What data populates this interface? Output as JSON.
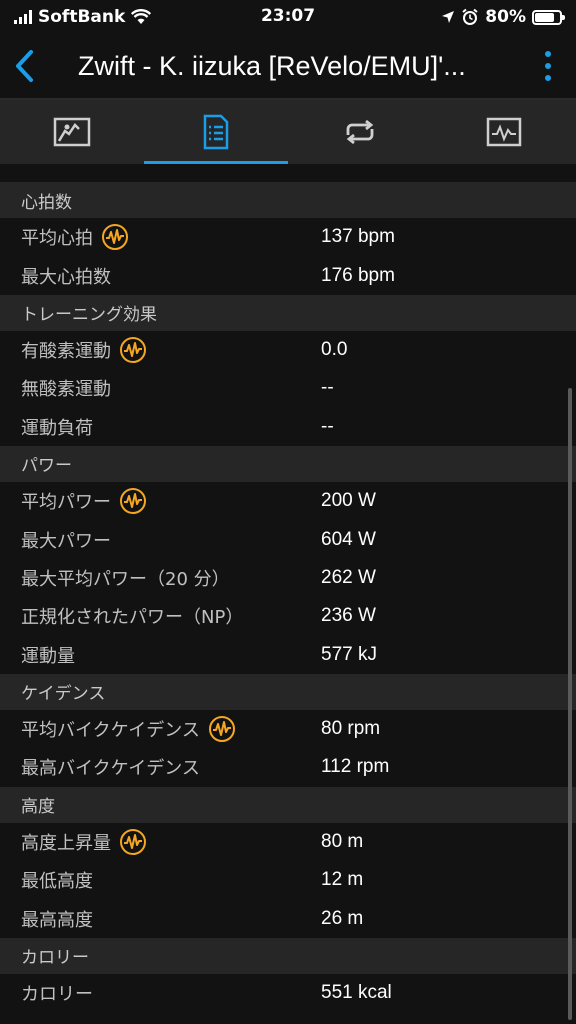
{
  "status_bar": {
    "carrier": "SoftBank",
    "time": "23:07",
    "battery": "80%",
    "battery_level": 0.8
  },
  "header": {
    "title": "Zwift - K. iizuka [ReVelo/EMU]'..."
  },
  "tabs": [
    {
      "name": "map",
      "icon": "map-icon",
      "active": false
    },
    {
      "name": "details",
      "icon": "document-icon",
      "active": true
    },
    {
      "name": "laps",
      "icon": "repeat-icon",
      "active": false
    },
    {
      "name": "charts",
      "icon": "chart-icon",
      "active": false
    }
  ],
  "sections": [
    {
      "title": "心拍数",
      "rows": [
        {
          "label": "平均心拍",
          "value": "137 bpm",
          "badge": true
        },
        {
          "label": "最大心拍数",
          "value": "176 bpm",
          "badge": false
        }
      ]
    },
    {
      "title": "トレーニング効果",
      "rows": [
        {
          "label": "有酸素運動",
          "value": "0.0",
          "badge": true
        },
        {
          "label": "無酸素運動",
          "value": "--",
          "badge": false
        },
        {
          "label": "運動負荷",
          "value": "--",
          "badge": false
        }
      ]
    },
    {
      "title": "パワー",
      "rows": [
        {
          "label": "平均パワー",
          "value": "200 W",
          "badge": true
        },
        {
          "label": "最大パワー",
          "value": "604 W",
          "badge": false
        },
        {
          "label": "最大平均パワー（20 分）",
          "value": "262 W",
          "badge": false
        },
        {
          "label": "正規化されたパワー（NP）",
          "value": "236 W",
          "badge": false
        },
        {
          "label": "運動量",
          "value": "577 kJ",
          "badge": false
        }
      ]
    },
    {
      "title": "ケイデンス",
      "rows": [
        {
          "label": "平均バイクケイデンス",
          "value": "80 rpm",
          "badge": true
        },
        {
          "label": "最高バイクケイデンス",
          "value": "112 rpm",
          "badge": false
        }
      ]
    },
    {
      "title": "高度",
      "rows": [
        {
          "label": "高度上昇量",
          "value": "80 m",
          "badge": true
        },
        {
          "label": "最低高度",
          "value": "12 m",
          "badge": false
        },
        {
          "label": "最高高度",
          "value": "26 m",
          "badge": false
        }
      ]
    },
    {
      "title": "カロリー",
      "rows": [
        {
          "label": "カロリー",
          "value": "551 kcal",
          "badge": false
        }
      ]
    }
  ],
  "colors": {
    "accent": "#1a9ee8",
    "badge": "#f5a623",
    "background": "#121212",
    "section_bg": "#262626"
  }
}
